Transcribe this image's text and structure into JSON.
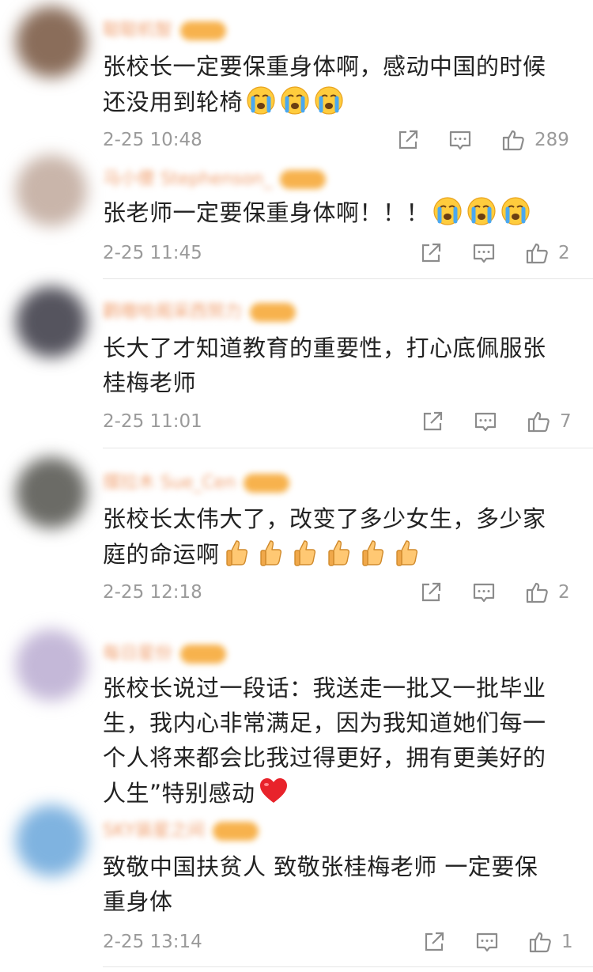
{
  "comments": [
    {
      "username": "聪聪机智",
      "text_lines": [
        "张校长一定要保重身体啊，感动中国的时候",
        "还没用到轮椅"
      ],
      "emoji": "crying-face",
      "emoji_count": 3,
      "time": "2-25 10:48",
      "likes": "289",
      "avatar_color": "#8a6d5a"
    },
    {
      "username": "马小傻 Stephenson_",
      "text_lines": [
        "张老师一定要保重身体啊！！！"
      ],
      "emoji": "crying-face",
      "emoji_count": 3,
      "time": "2-25 11:45",
      "likes": "2",
      "avatar_color": "#c9b5aa"
    },
    {
      "username": "鹳嗷哈阁采西努力",
      "text_lines": [
        "长大了才知道教育的重要性，打心底佩服张",
        "桂梅老师"
      ],
      "emoji": "",
      "emoji_count": 0,
      "time": "2-25 11:01",
      "likes": "7",
      "avatar_color": "#55545e"
    },
    {
      "username": "摆拉木 Sue_Cen",
      "text_lines": [
        "张校长太伟大了，改变了多少女生，多少家",
        "庭的命运啊"
      ],
      "emoji": "thumbs-up",
      "emoji_count": 6,
      "time": "2-25 12:18",
      "likes": "2",
      "avatar_color": "#6b6b66"
    },
    {
      "username": "每日星份",
      "text_lines": [
        "张校长说过一段话：我送走一批又一批毕业",
        "生，我内心非常满足，因为我知道她们每一",
        "个人将来都会比我过得更好，拥有更美好的",
        "人生”特别感动"
      ],
      "emoji": "red-heart",
      "emoji_count": 1,
      "time": "",
      "likes": "",
      "avatar_color": "#c4b8d8"
    },
    {
      "username": "SKY装星之间",
      "text_lines": [
        "致敬中国扶贫人 致敬张桂梅老师 一定要保",
        "重身体"
      ],
      "emoji": "",
      "emoji_count": 0,
      "time": "2-25 13:14",
      "likes": "1",
      "avatar_color": "#7fb3e0"
    }
  ],
  "icons": {
    "share": "share-icon",
    "reply": "comment-icon",
    "like": "thumbs-up-icon"
  }
}
